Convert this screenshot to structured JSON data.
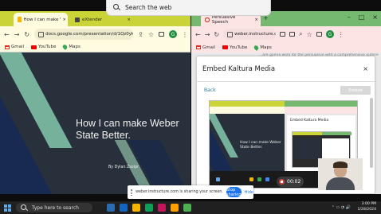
{
  "search_overlay": {
    "label": "Search the web"
  },
  "left_browser": {
    "tabs": [
      {
        "label": "How I can make Webe"
      },
      {
        "label": "eXtender"
      }
    ],
    "url": "docs.google.com/presentation/d/1Qz0yk...",
    "bookmarks": [
      "Gmail",
      "YouTube",
      "Maps"
    ],
    "slide": {
      "title": "How I can make Weber State Better.",
      "byline": "By Dylan Zsoipr"
    }
  },
  "right_browser": {
    "tab": {
      "label": "Persuasive Speech"
    },
    "url": "weber.instructure.com/co...",
    "profile_initial": "G",
    "bookmarks": [
      "Gmail",
      "YouTube",
      "Maps"
    ],
    "background_text": "...are gonna work for the persuasive with a comprehensive outline of your...",
    "modal": {
      "title": "Embed Kaltura Media",
      "close": "×",
      "back": "Back",
      "embed": "Embed",
      "preview": {
        "slide_title": "How I can make Weber State Better.",
        "inner_title": "Embed Kaltura Media"
      },
      "recording_time": "00:02"
    }
  },
  "share_bar": {
    "message": "weber.instructure.com is sharing your screen.",
    "stop": "Stop sharing",
    "hide": "Hide"
  },
  "taskbar": {
    "search_placeholder": "Type here to search",
    "time": "3:00 PM",
    "date": "1/28/2024"
  },
  "colors": {
    "left_chrome": "#cbd437",
    "right_chrome": "#75b870",
    "slide_bg": "#28303b",
    "accent_green": "#76b19c",
    "stop_button": "#1a73e8",
    "record": "#e0403a"
  }
}
